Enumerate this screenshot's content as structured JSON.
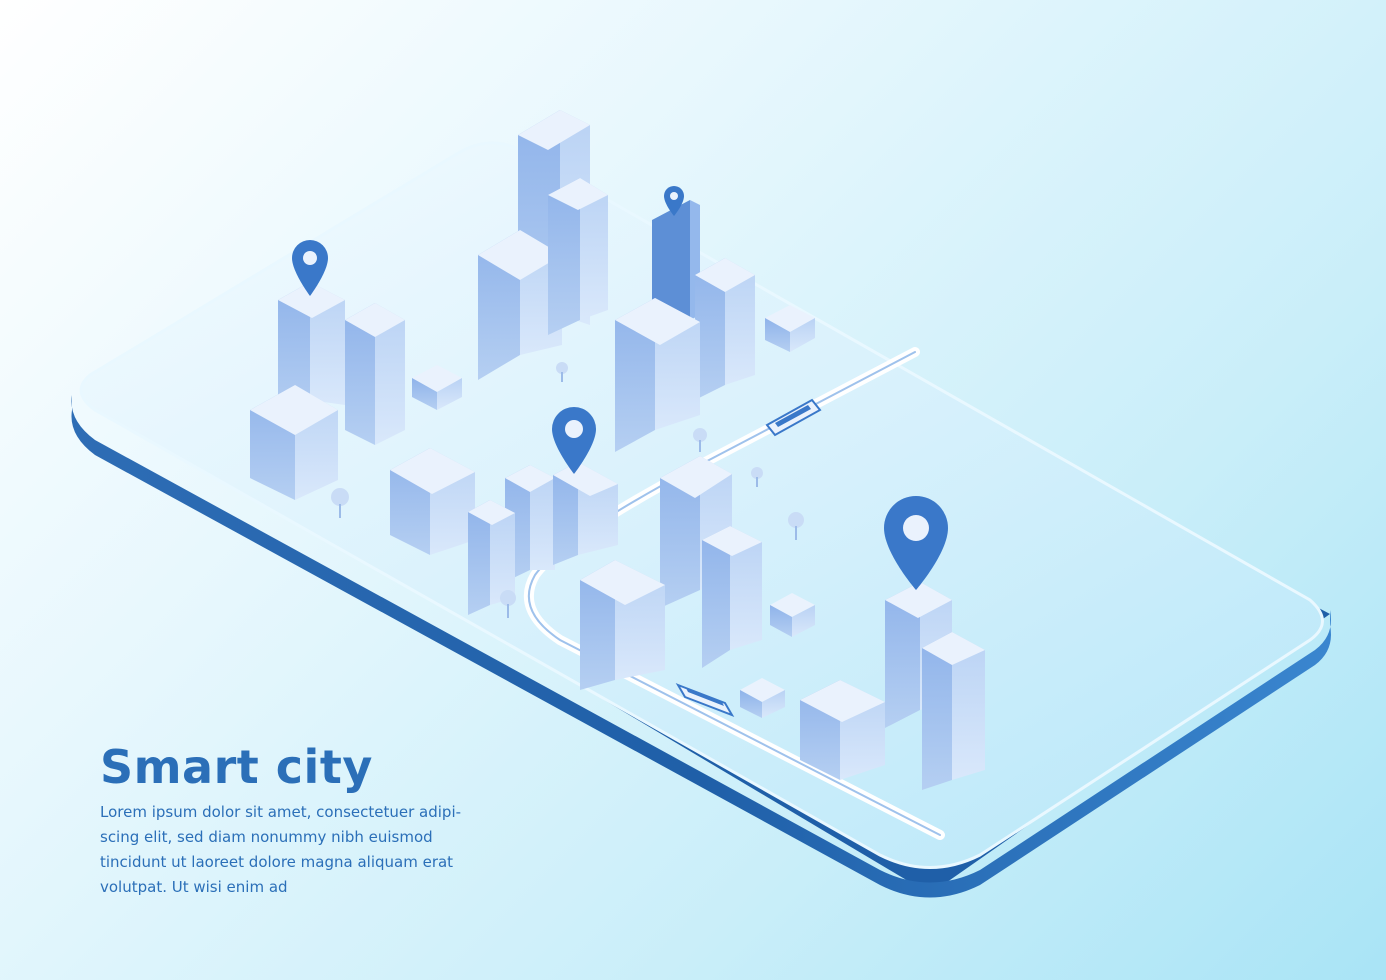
{
  "title": "Smart city",
  "body_lines": [
    "Lorem ipsum dolor sit amet, consectetuer adipi-",
    "scing elit, sed diam nonummy nibh euismod",
    "tincidunt ut laoreet dolore magna aliquam erat",
    "volutpat. Ut wisi enim ad"
  ],
  "icons": [
    "map-pin-icon",
    "train-icon",
    "tree-icon",
    "building-icon",
    "smartphone-icon"
  ],
  "colors": {
    "heading": "#2b6fb8",
    "body": "#2b6fb8",
    "pin": "#3a78c9",
    "phone_edge": "#1f5fa8",
    "building_front": "#7fa9e3",
    "building_side": "#a8c7ef",
    "building_top": "#e6f0fc"
  }
}
